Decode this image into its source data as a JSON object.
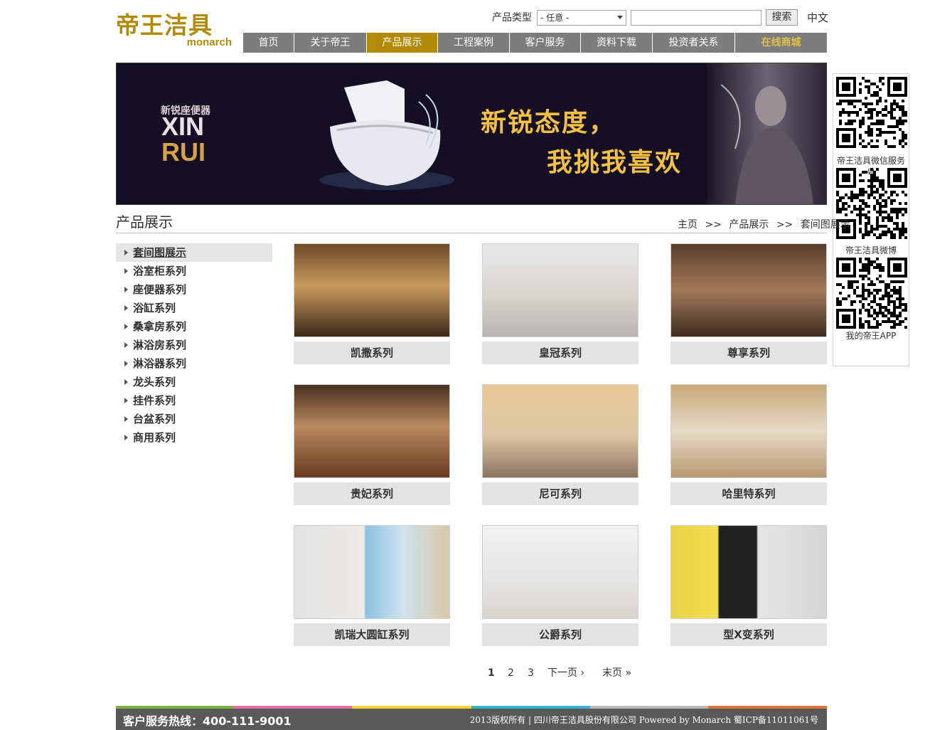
{
  "logo": {
    "cn": "帝王洁具",
    "en": "monarch"
  },
  "search": {
    "label": "产品类型",
    "select_value": "- 任意 -",
    "button": "搜索",
    "lang": "中文"
  },
  "nav": [
    {
      "label": "首页"
    },
    {
      "label": "关于帝王"
    },
    {
      "label": "产品展示",
      "active": true
    },
    {
      "label": "工程案例"
    },
    {
      "label": "客户服务"
    },
    {
      "label": "资料下载"
    },
    {
      "label": "投资者关系"
    },
    {
      "label": "在线商城"
    }
  ],
  "banner": {
    "sub": "新锐座便器",
    "line1": "XIN",
    "line2": "RUI",
    "slogan1": "新锐态度，",
    "slogan2": "我挑我喜欢"
  },
  "qr": [
    {
      "caption": "帝王洁具微信服务号"
    },
    {
      "caption": "帝王洁具微博"
    },
    {
      "caption": "我的帝王APP"
    }
  ],
  "section": {
    "title": "产品展示"
  },
  "breadcrumb": {
    "home": "主页",
    "sep1": ">>",
    "mid": "产品展示",
    "sep2": ">>",
    "current": "套间图展示"
  },
  "sidebar": [
    {
      "label": "套间图展示",
      "active": true
    },
    {
      "label": "浴室柜系列"
    },
    {
      "label": "座便器系列"
    },
    {
      "label": "浴缸系列"
    },
    {
      "label": "桑拿房系列"
    },
    {
      "label": "淋浴房系列"
    },
    {
      "label": "淋浴器系列"
    },
    {
      "label": "龙头系列"
    },
    {
      "label": "挂件系列"
    },
    {
      "label": "台盆系列"
    },
    {
      "label": "商用系列"
    }
  ],
  "products": [
    {
      "name": "凯撒系列"
    },
    {
      "name": "皇冠系列"
    },
    {
      "name": "尊享系列"
    },
    {
      "name": "贵妃系列"
    },
    {
      "name": "尼可系列"
    },
    {
      "name": "哈里特系列"
    },
    {
      "name": "凯瑞大圆缸系列"
    },
    {
      "name": "公爵系列"
    },
    {
      "name": "型X变系列"
    }
  ],
  "pager": {
    "p1": "1",
    "p2": "2",
    "p3": "3",
    "next": "下一页 ›",
    "last": "末页 »"
  },
  "footer": {
    "hotline": "客户服务热线：400-111-9001",
    "copyright": "2013版权所有 | 四川帝王洁具股份有限公司 Powered by Monarch  蜀ICP备11011061号"
  },
  "colors": {
    "brand": "#b28a0a",
    "nav": "#7d7d7d",
    "footer": "#595959"
  }
}
